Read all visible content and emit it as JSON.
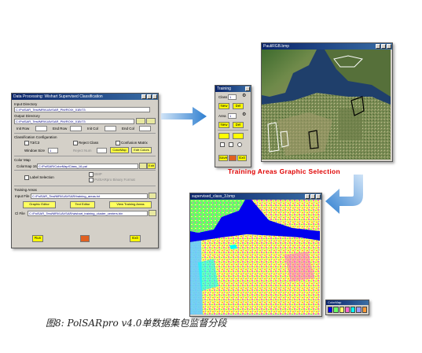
{
  "left_window": {
    "title": "Data Processing: Wishart Supervised Classification",
    "input_label": "Input Directory",
    "input_path": "C:/PolSAR_Test/MRI/UAVSAR_PM/ROIX_01B/T3",
    "output_label": "Output Directory",
    "output_path": "C:/PolSAR_Test/MRI/UAVSAR_PM/ROIX_01B/T3",
    "init_row": "Init Row",
    "end_row": "End Row",
    "init_col": "Init Col",
    "end_col": "End Col",
    "config_label": "Classification Configuration",
    "opt_t3": "T3/C3",
    "opt_reject": "Reject Class",
    "opt_confusion": "Confusion Matrix",
    "window_size": "Window Size",
    "window_value": "1",
    "reject_num": "Reject Num",
    "btn_matrix": "ColorMap",
    "btn_edit": "Edit Colors",
    "color_label": "Color Map",
    "colormap_label": "Colormap 16",
    "colormap_path": "C:/PolSAR/ColorMap/Class_16.pal",
    "btn_edit2": "Edit",
    "label_area": "Label Selection",
    "opt_bmp": "BMP",
    "opt_polsar_bmp": "PolSARpro Binary Format",
    "training_label": "Training Areas",
    "input_file_label": "Input File",
    "input_file_path": "C:/PolSAR_Test/MRI/UAVSAR/training_areas.txt",
    "btn_graphic": "Graphic Editor",
    "btn_text": "Text Editor",
    "btn_view": "View Training Areas",
    "cl_file_label": "Cl File",
    "cl_file_path": "C:/PolSAR_Test/MRI/UAVSAR/wishart_training_cluster_centers.bin",
    "btn_run": "Run",
    "btn_exit": "Exit"
  },
  "training_window": {
    "title": "Training",
    "class_label": "Class",
    "class_value": "1",
    "area_label": "Area",
    "area_value": "1",
    "btn_new": "New",
    "btn_del": "Del",
    "btn_save": "Save",
    "btn_exit": "Exit"
  },
  "top_image_window": {
    "title": "PauliRGB.bmp"
  },
  "caption_red": "Training Areas Graphic Selection",
  "bottom_image_window": {
    "title": "supervised_class_3.bmp"
  },
  "colormap_window": {
    "title": "ColorMap"
  },
  "figure_caption": "图8: PolSARpro v4.0单数据集包监督分段",
  "colors": {
    "titlebar": "#0a246a",
    "arrow": "#3e8ad8",
    "red_title": "#e00000",
    "button_yellow": "#ffff00"
  }
}
